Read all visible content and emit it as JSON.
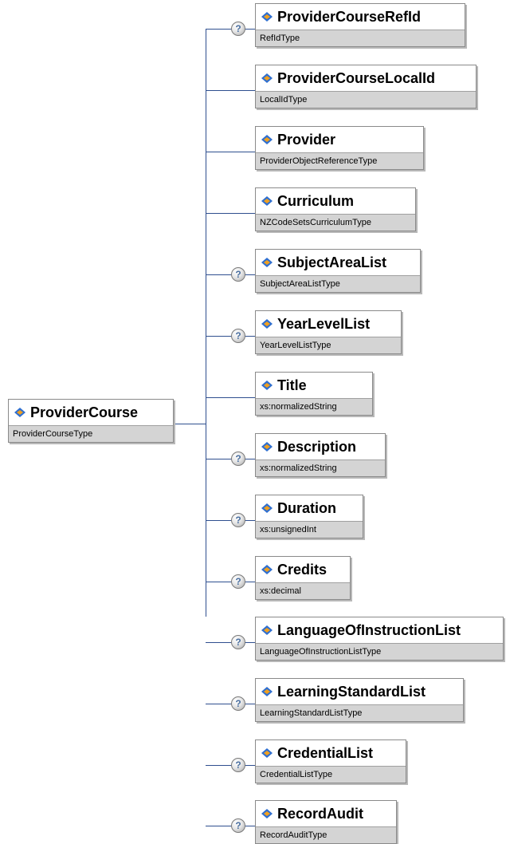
{
  "root": {
    "name": "ProviderCourse",
    "type": "ProviderCourseType"
  },
  "optional_marker": "?",
  "children": [
    {
      "name": "ProviderCourseRefId",
      "type": "RefIdType",
      "optional": true
    },
    {
      "name": "ProviderCourseLocalId",
      "type": "LocalIdType",
      "optional": false
    },
    {
      "name": "Provider",
      "type": "ProviderObjectReferenceType",
      "optional": false
    },
    {
      "name": "Curriculum",
      "type": "NZCodeSetsCurriculumType",
      "optional": false
    },
    {
      "name": "SubjectAreaList",
      "type": "SubjectAreaListType",
      "optional": true
    },
    {
      "name": "YearLevelList",
      "type": "YearLevelListType",
      "optional": true
    },
    {
      "name": "Title",
      "type": "xs:normalizedString",
      "optional": false
    },
    {
      "name": "Description",
      "type": "xs:normalizedString",
      "optional": true
    },
    {
      "name": "Duration",
      "type": "xs:unsignedInt",
      "optional": true
    },
    {
      "name": "Credits",
      "type": "xs:decimal",
      "optional": true
    },
    {
      "name": "LanguageOfInstructionList",
      "type": "LanguageOfInstructionListType",
      "optional": true
    },
    {
      "name": "LearningStandardList",
      "type": "LearningStandardListType",
      "optional": true
    },
    {
      "name": "CredentialList",
      "type": "CredentialListType",
      "optional": true
    },
    {
      "name": "RecordAudit",
      "type": "RecordAuditType",
      "optional": true
    }
  ],
  "colors": {
    "connector": "#2f4f8f",
    "type_band": "#d4d4d4",
    "icon_blue": "#2f6fd0",
    "icon_orange": "#f0a020"
  }
}
